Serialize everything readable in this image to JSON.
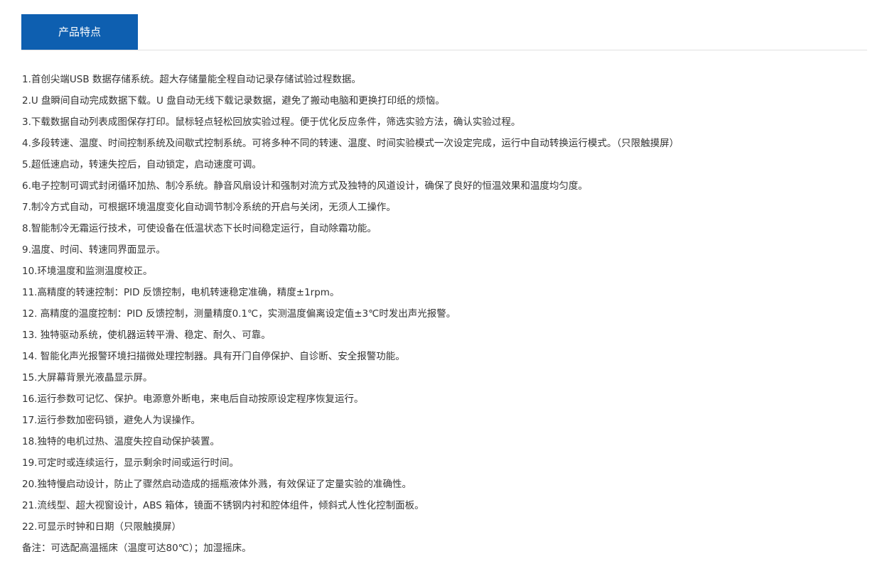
{
  "tabs": {
    "active_label": "产品特点"
  },
  "features": [
    "1.首创尖端USB 数据存储系统。超大存储量能全程自动记录存储试验过程数据。",
    "2.U 盘瞬间自动完成数据下载。U 盘自动无线下载记录数据，避免了搬动电脑和更换打印纸的烦恼。",
    "3.下载数据自动列表成图保存打印。鼠标轻点轻松回放实验过程。便于优化反应条件，筛选实验方法，确认实验过程。",
    "4.多段转速、温度、时间控制系统及间歇式控制系统。可将多种不同的转速、温度、时间实验模式一次设定完成，运行中自动转换运行模式。（只限触摸屏）",
    "5.超低速启动，转速失控后，自动锁定，启动速度可调。",
    "6.电子控制可调式封闭循环加热、制冷系统。静音风扇设计和强制对流方式及独特的风道设计，确保了良好的恒温效果和温度均匀度。",
    "7.制冷方式自动，可根据环境温度变化自动调节制冷系统的开启与关闭，无须人工操作。",
    "8.智能制冷无霜运行技术，可使设备在低温状态下长时间稳定运行，自动除霜功能。",
    "9.温度、时间、转速同界面显示。",
    "10.环境温度和监测温度校正。",
    "11.高精度的转速控制：PID 反馈控制，电机转速稳定准确，精度±1rpm。",
    "12. 高精度的温度控制：PID 反馈控制，测量精度0.1℃，实测温度偏离设定值±3℃时发出声光报警。",
    "13. 独特驱动系统，使机器运转平滑、稳定、耐久、可靠。",
    "14. 智能化声光报警环境扫描微处理控制器。具有开门自停保护、自诊断、安全报警功能。",
    "15.大屏幕背景光液晶显示屏。",
    "16.运行参数可记忆、保护。电源意外断电，来电后自动按原设定程序恢复运行。",
    "17.运行参数加密码锁，避免人为误操作。",
    "18.独特的电机过热、温度失控自动保护装置。",
    "19.可定时或连续运行，显示剩余时间或运行时间。",
    "20.独特慢启动设计，防止了骤然启动造成的摇瓶液体外溅，有效保证了定量实验的准确性。",
    "21.流线型、超大视窗设计，ABS 箱体，镜面不锈钢内衬和腔体组件，倾斜式人性化控制面板。",
    "22.可显示时钟和日期（只限触摸屏）",
    "备注：可选配高温摇床（温度可达80℃）；加湿摇床。"
  ],
  "colors": {
    "tab_active_bg": "#0e5fb0",
    "text": "#333333",
    "divider": "#e2e2e2"
  }
}
